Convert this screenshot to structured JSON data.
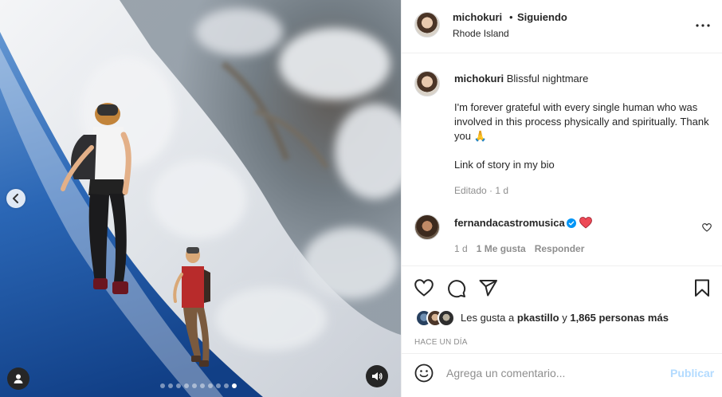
{
  "post": {
    "author": "michokuri",
    "separator": "•",
    "follow_state": "Siguiendo",
    "location": "Rhode Island"
  },
  "caption": {
    "author": "michokuri",
    "title": "Blissful nightmare",
    "paragraph_1": "I'm forever grateful with every single human who was involved in this process physically and spiritually. Thank you 🙏",
    "paragraph_2": "Link of story in my bio",
    "meta": "Editado · 1 d"
  },
  "comment": {
    "author": "fernandacastromusica",
    "time": "1 d",
    "likes": "1 Me gusta",
    "reply": "Responder"
  },
  "likes": {
    "prefix": "Les gusta a",
    "first_user": "pkastillo",
    "conjunction": "y",
    "others": "1,865 personas más"
  },
  "timestamp": "HACE UN DÍA",
  "add_comment": {
    "placeholder": "Agrega un comentario...",
    "post_label": "Publicar"
  },
  "carousel": {
    "slide_count": 10,
    "active_index": 9
  },
  "colors": {
    "verified": "#0095f6",
    "heart": "#ed4956",
    "post_disabled": "#b3dbff",
    "secondary_text": "#8e8e8e"
  },
  "icons": {
    "more": "more-horizontal-icon",
    "like": "heart-outline-icon",
    "comment": "comment-bubble-icon",
    "share": "paper-plane-icon",
    "save": "bookmark-icon",
    "emoji": "smiley-icon",
    "prev": "chevron-left-icon",
    "tag": "user-tag-icon",
    "audio": "speaker-icon"
  }
}
